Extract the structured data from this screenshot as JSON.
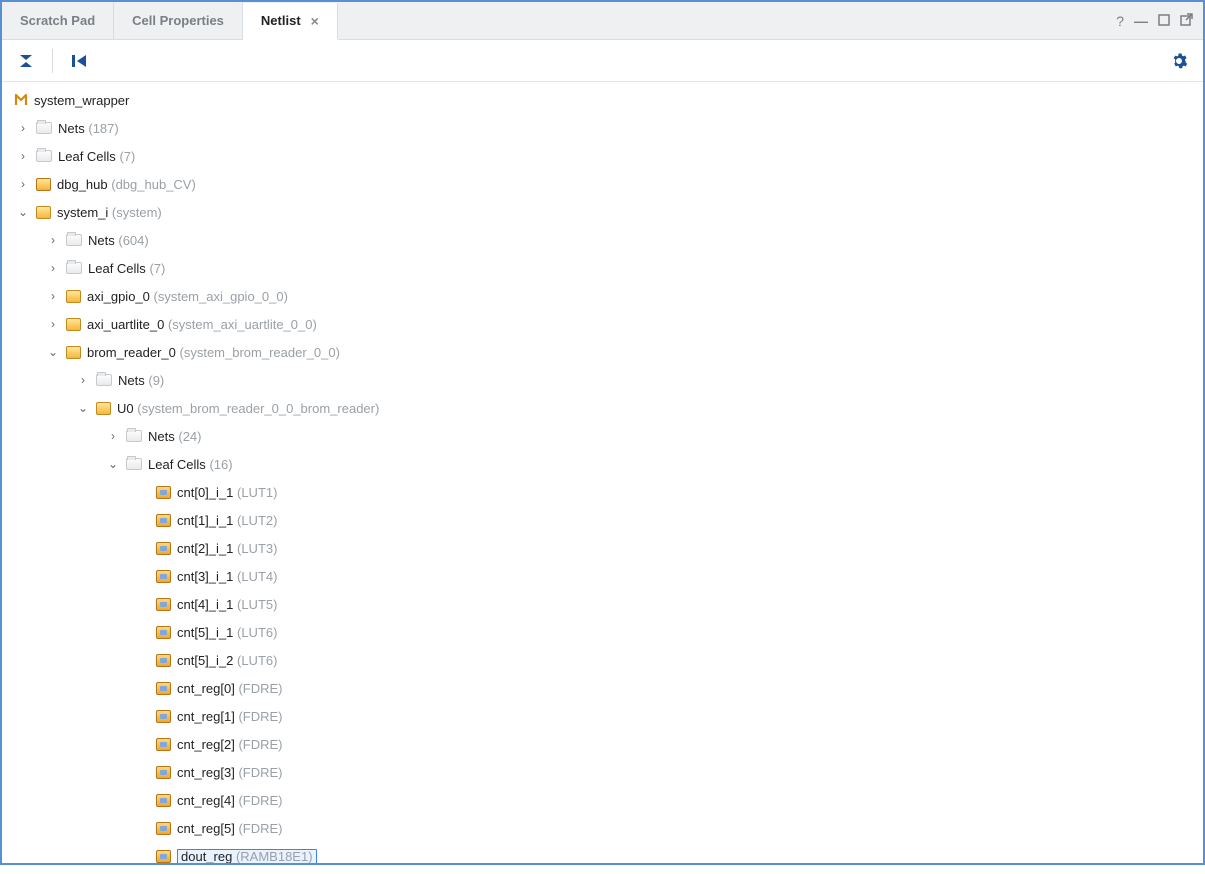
{
  "tabs": [
    {
      "label": "Scratch Pad",
      "active": false
    },
    {
      "label": "Cell Properties",
      "active": false
    },
    {
      "label": "Netlist",
      "active": true
    }
  ],
  "tree": {
    "root": {
      "name": "system_wrapper"
    },
    "r0": {
      "name": "Nets",
      "count": "(187)"
    },
    "r1": {
      "name": "Leaf Cells",
      "count": "(7)"
    },
    "r2": {
      "name": "dbg_hub",
      "type": "(dbg_hub_CV)"
    },
    "r3": {
      "name": "system_i",
      "type": "(system)"
    },
    "r4": {
      "name": "Nets",
      "count": "(604)"
    },
    "r5": {
      "name": "Leaf Cells",
      "count": "(7)"
    },
    "r6": {
      "name": "axi_gpio_0",
      "type": "(system_axi_gpio_0_0)"
    },
    "r7": {
      "name": "axi_uartlite_0",
      "type": "(system_axi_uartlite_0_0)"
    },
    "r8": {
      "name": "brom_reader_0",
      "type": "(system_brom_reader_0_0)"
    },
    "r9": {
      "name": "Nets",
      "count": "(9)"
    },
    "r10": {
      "name": "U0",
      "type": "(system_brom_reader_0_0_brom_reader)"
    },
    "r11": {
      "name": "Nets",
      "count": "(24)"
    },
    "r12": {
      "name": "Leaf Cells",
      "count": "(16)"
    },
    "r13": {
      "name": "cnt[0]_i_1",
      "type": "(LUT1)"
    },
    "r14": {
      "name": "cnt[1]_i_1",
      "type": "(LUT2)"
    },
    "r15": {
      "name": "cnt[2]_i_1",
      "type": "(LUT3)"
    },
    "r16": {
      "name": "cnt[3]_i_1",
      "type": "(LUT4)"
    },
    "r17": {
      "name": "cnt[4]_i_1",
      "type": "(LUT5)"
    },
    "r18": {
      "name": "cnt[5]_i_1",
      "type": "(LUT6)"
    },
    "r19": {
      "name": "cnt[5]_i_2",
      "type": "(LUT6)"
    },
    "r20": {
      "name": "cnt_reg[0]",
      "type": "(FDRE)"
    },
    "r21": {
      "name": "cnt_reg[1]",
      "type": "(FDRE)"
    },
    "r22": {
      "name": "cnt_reg[2]",
      "type": "(FDRE)"
    },
    "r23": {
      "name": "cnt_reg[3]",
      "type": "(FDRE)"
    },
    "r24": {
      "name": "cnt_reg[4]",
      "type": "(FDRE)"
    },
    "r25": {
      "name": "cnt_reg[5]",
      "type": "(FDRE)"
    },
    "r26": {
      "name": "dout_reg",
      "type": "(RAMB18E1)"
    }
  }
}
